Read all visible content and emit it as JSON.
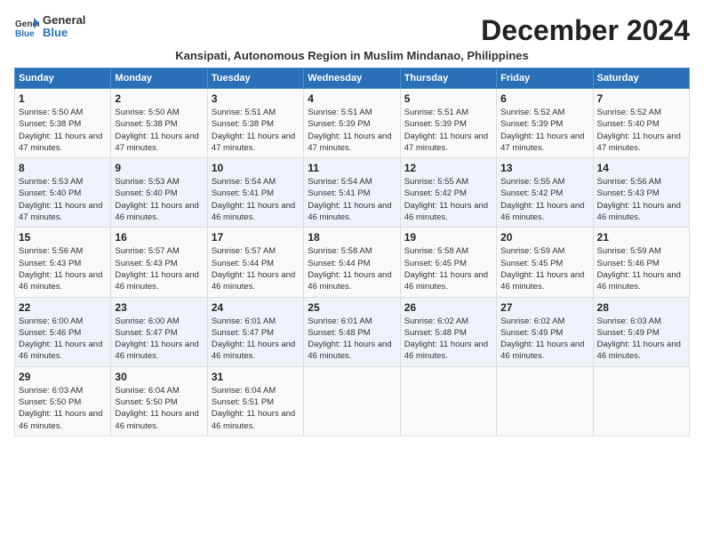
{
  "header": {
    "logo_line1": "General",
    "logo_line2": "Blue",
    "main_title": "December 2024",
    "subtitle": "Kansipati, Autonomous Region in Muslim Mindanao, Philippines"
  },
  "columns": [
    "Sunday",
    "Monday",
    "Tuesday",
    "Wednesday",
    "Thursday",
    "Friday",
    "Saturday"
  ],
  "weeks": [
    [
      {
        "day": "1",
        "sunrise": "5:50 AM",
        "sunset": "5:38 PM",
        "daylight": "11 hours and 47 minutes."
      },
      {
        "day": "2",
        "sunrise": "5:50 AM",
        "sunset": "5:38 PM",
        "daylight": "11 hours and 47 minutes."
      },
      {
        "day": "3",
        "sunrise": "5:51 AM",
        "sunset": "5:38 PM",
        "daylight": "11 hours and 47 minutes."
      },
      {
        "day": "4",
        "sunrise": "5:51 AM",
        "sunset": "5:39 PM",
        "daylight": "11 hours and 47 minutes."
      },
      {
        "day": "5",
        "sunrise": "5:51 AM",
        "sunset": "5:39 PM",
        "daylight": "11 hours and 47 minutes."
      },
      {
        "day": "6",
        "sunrise": "5:52 AM",
        "sunset": "5:39 PM",
        "daylight": "11 hours and 47 minutes."
      },
      {
        "day": "7",
        "sunrise": "5:52 AM",
        "sunset": "5:40 PM",
        "daylight": "11 hours and 47 minutes."
      }
    ],
    [
      {
        "day": "8",
        "sunrise": "5:53 AM",
        "sunset": "5:40 PM",
        "daylight": "11 hours and 47 minutes."
      },
      {
        "day": "9",
        "sunrise": "5:53 AM",
        "sunset": "5:40 PM",
        "daylight": "11 hours and 46 minutes."
      },
      {
        "day": "10",
        "sunrise": "5:54 AM",
        "sunset": "5:41 PM",
        "daylight": "11 hours and 46 minutes."
      },
      {
        "day": "11",
        "sunrise": "5:54 AM",
        "sunset": "5:41 PM",
        "daylight": "11 hours and 46 minutes."
      },
      {
        "day": "12",
        "sunrise": "5:55 AM",
        "sunset": "5:42 PM",
        "daylight": "11 hours and 46 minutes."
      },
      {
        "day": "13",
        "sunrise": "5:55 AM",
        "sunset": "5:42 PM",
        "daylight": "11 hours and 46 minutes."
      },
      {
        "day": "14",
        "sunrise": "5:56 AM",
        "sunset": "5:43 PM",
        "daylight": "11 hours and 46 minutes."
      }
    ],
    [
      {
        "day": "15",
        "sunrise": "5:56 AM",
        "sunset": "5:43 PM",
        "daylight": "11 hours and 46 minutes."
      },
      {
        "day": "16",
        "sunrise": "5:57 AM",
        "sunset": "5:43 PM",
        "daylight": "11 hours and 46 minutes."
      },
      {
        "day": "17",
        "sunrise": "5:57 AM",
        "sunset": "5:44 PM",
        "daylight": "11 hours and 46 minutes."
      },
      {
        "day": "18",
        "sunrise": "5:58 AM",
        "sunset": "5:44 PM",
        "daylight": "11 hours and 46 minutes."
      },
      {
        "day": "19",
        "sunrise": "5:58 AM",
        "sunset": "5:45 PM",
        "daylight": "11 hours and 46 minutes."
      },
      {
        "day": "20",
        "sunrise": "5:59 AM",
        "sunset": "5:45 PM",
        "daylight": "11 hours and 46 minutes."
      },
      {
        "day": "21",
        "sunrise": "5:59 AM",
        "sunset": "5:46 PM",
        "daylight": "11 hours and 46 minutes."
      }
    ],
    [
      {
        "day": "22",
        "sunrise": "6:00 AM",
        "sunset": "5:46 PM",
        "daylight": "11 hours and 46 minutes."
      },
      {
        "day": "23",
        "sunrise": "6:00 AM",
        "sunset": "5:47 PM",
        "daylight": "11 hours and 46 minutes."
      },
      {
        "day": "24",
        "sunrise": "6:01 AM",
        "sunset": "5:47 PM",
        "daylight": "11 hours and 46 minutes."
      },
      {
        "day": "25",
        "sunrise": "6:01 AM",
        "sunset": "5:48 PM",
        "daylight": "11 hours and 46 minutes."
      },
      {
        "day": "26",
        "sunrise": "6:02 AM",
        "sunset": "5:48 PM",
        "daylight": "11 hours and 46 minutes."
      },
      {
        "day": "27",
        "sunrise": "6:02 AM",
        "sunset": "5:49 PM",
        "daylight": "11 hours and 46 minutes."
      },
      {
        "day": "28",
        "sunrise": "6:03 AM",
        "sunset": "5:49 PM",
        "daylight": "11 hours and 46 minutes."
      }
    ],
    [
      {
        "day": "29",
        "sunrise": "6:03 AM",
        "sunset": "5:50 PM",
        "daylight": "11 hours and 46 minutes."
      },
      {
        "day": "30",
        "sunrise": "6:04 AM",
        "sunset": "5:50 PM",
        "daylight": "11 hours and 46 minutes."
      },
      {
        "day": "31",
        "sunrise": "6:04 AM",
        "sunset": "5:51 PM",
        "daylight": "11 hours and 46 minutes."
      },
      null,
      null,
      null,
      null
    ]
  ]
}
